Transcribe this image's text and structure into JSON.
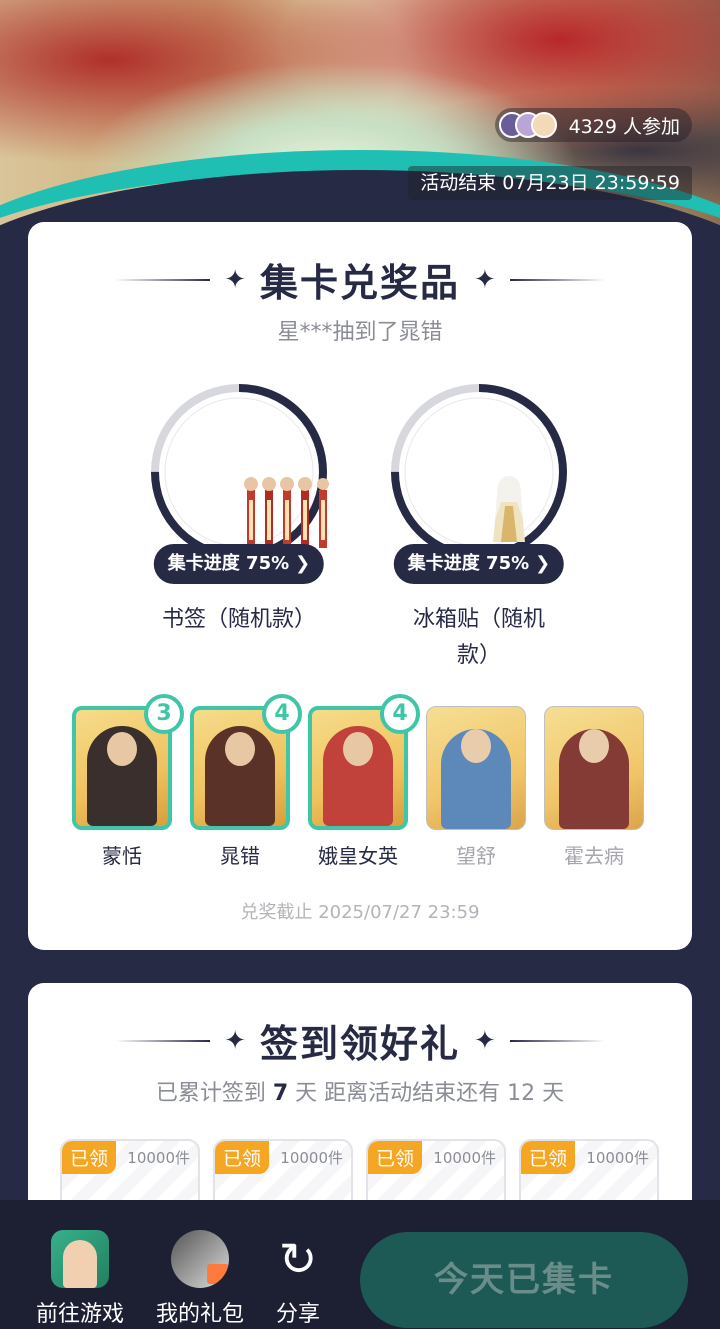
{
  "banner": {
    "participants": "4329 人参加",
    "end_time": "活动结束 07月23日 23:59:59"
  },
  "collect": {
    "title": "集卡兑奖品",
    "subtitle": "星***抽到了晁错",
    "prizes": [
      {
        "progress": "集卡进度 75%",
        "progress_value": 0.75,
        "name": "书签（随机款）"
      },
      {
        "progress": "集卡进度 75%",
        "progress_value": 0.75,
        "name": "冰箱贴（随机款）"
      }
    ],
    "characters": [
      {
        "name": "蒙恬",
        "count": "3",
        "owned": true
      },
      {
        "name": "晁错",
        "count": "4",
        "owned": true
      },
      {
        "name": "娥皇女英",
        "count": "4",
        "owned": true
      },
      {
        "name": "望舒",
        "count": "",
        "owned": false
      },
      {
        "name": "霍去病",
        "count": "",
        "owned": false
      }
    ],
    "deadline": "兑奖截止 2025/07/27 23:59"
  },
  "checkin": {
    "title": "签到领好礼",
    "summary": {
      "prefix": "已累计签到 ",
      "days": "7",
      "middle": " 天  距离活动结束还有 12 天"
    },
    "rewards": [
      {
        "status": "已领",
        "qty": "10000件"
      },
      {
        "status": "已领",
        "qty": "10000件"
      },
      {
        "status": "已领",
        "qty": "10000件"
      },
      {
        "status": "已领",
        "qty": "10000件"
      }
    ]
  },
  "bottom": {
    "goto_game": "前往游戏",
    "my_gifts": "我的礼包",
    "share": "分享",
    "cta": "今天已集卡"
  },
  "colors": {
    "navy": "#272a45",
    "teal": "#3fc6a7",
    "claimed": "#f5a623",
    "cta_bg": "#1e5a55"
  }
}
